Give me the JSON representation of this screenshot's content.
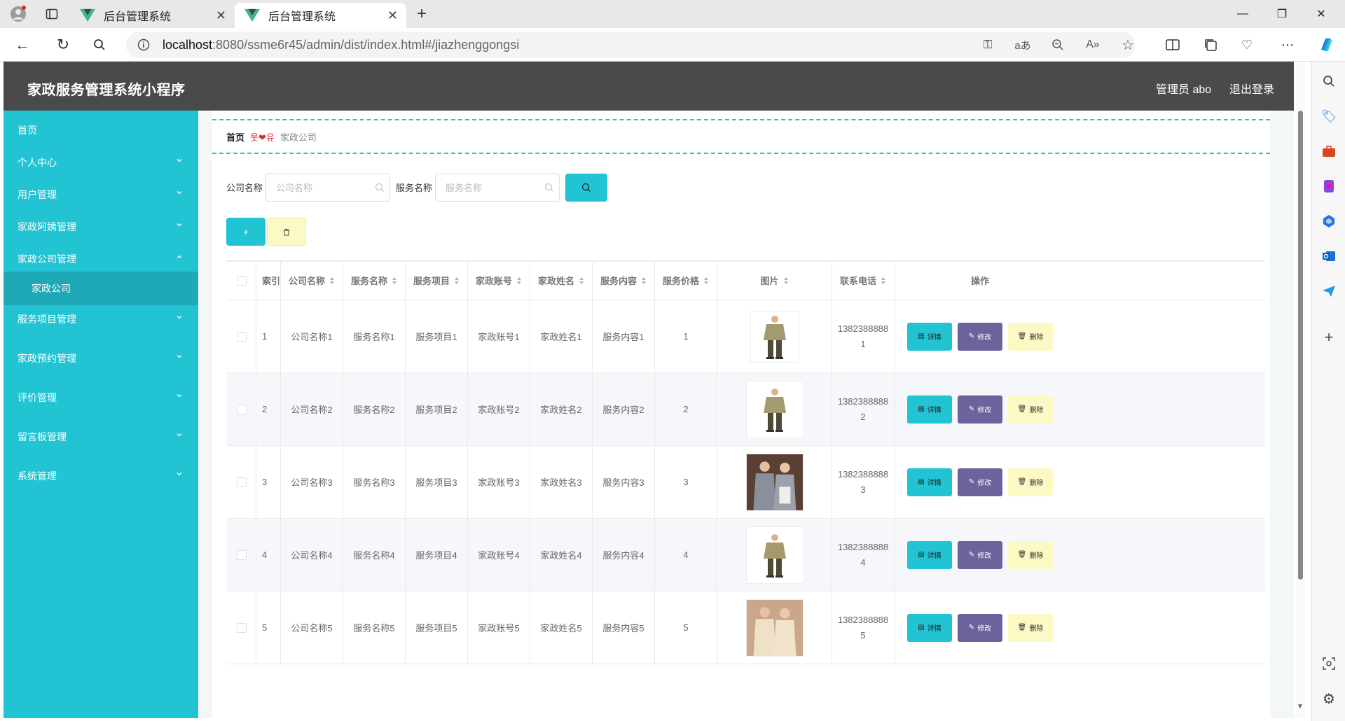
{
  "browser": {
    "tabs": [
      {
        "title": "后台管理系统",
        "active": false
      },
      {
        "title": "后台管理系统",
        "active": true
      }
    ],
    "url_host": "localhost",
    "url_rest": ":8080/ssme6r45/admin/dist/index.html#/jiazhenggongsi",
    "accent": "#22c3d2"
  },
  "app": {
    "title": "家政服务管理系统小程序",
    "admin_label": "管理员 abo",
    "logout_label": "退出登录"
  },
  "sidebar": {
    "items": [
      {
        "label": "首页",
        "expandable": false
      },
      {
        "label": "个人中心",
        "expandable": true
      },
      {
        "label": "用户管理",
        "expandable": true
      },
      {
        "label": "家政阿姨管理",
        "expandable": true
      },
      {
        "label": "家政公司管理",
        "expandable": true,
        "expanded": true
      },
      {
        "label": "家政公司",
        "sub": true
      },
      {
        "label": "服务项目管理",
        "expandable": true
      },
      {
        "label": "家政预约管理",
        "expandable": true
      },
      {
        "label": "评价管理",
        "expandable": true
      },
      {
        "label": "留言板管理",
        "expandable": true
      },
      {
        "label": "系统管理",
        "expandable": true
      }
    ]
  },
  "breadcrumb": {
    "home": "首页",
    "separator": "웃❤유",
    "current": "家政公司"
  },
  "search": {
    "company_label": "公司名称",
    "company_placeholder": "公司名称",
    "service_label": "服务名称",
    "service_placeholder": "服务名称"
  },
  "toolbar": {
    "add_label": "+",
    "delete_icon": "trash-icon"
  },
  "table": {
    "columns": [
      "索引",
      "公司名称",
      "服务名称",
      "服务项目",
      "家政账号",
      "家政姓名",
      "服务内容",
      "服务价格",
      "图片",
      "联系电话",
      "操作"
    ],
    "actions": {
      "detail": "详情",
      "edit": "修改",
      "remove": "删除"
    },
    "rows": [
      {
        "index": "1",
        "company": "公司名称1",
        "service": "服务名称1",
        "item": "服务项目1",
        "account": "家政账号1",
        "name": "家政姓名1",
        "content": "服务内容1",
        "price": "1",
        "phone_a": "1382388888",
        "phone_b": "1",
        "image": "uniform-single"
      },
      {
        "index": "2",
        "company": "公司名称2",
        "service": "服务名称2",
        "item": "服务项目2",
        "account": "家政账号2",
        "name": "家政姓名2",
        "content": "服务内容2",
        "price": "2",
        "phone_a": "1382388888",
        "phone_b": "2",
        "image": "uniform-single"
      },
      {
        "index": "3",
        "company": "公司名称3",
        "service": "服务名称3",
        "item": "服务项目3",
        "account": "家政账号3",
        "name": "家政姓名3",
        "content": "服务内容3",
        "price": "3",
        "phone_a": "1382388888",
        "phone_b": "3",
        "image": "uniform-pair-grey"
      },
      {
        "index": "4",
        "company": "公司名称4",
        "service": "服务名称4",
        "item": "服务项目4",
        "account": "家政账号4",
        "name": "家政姓名4",
        "content": "服务内容4",
        "price": "4",
        "phone_a": "1382388888",
        "phone_b": "4",
        "image": "uniform-single"
      },
      {
        "index": "5",
        "company": "公司名称5",
        "service": "服务名称5",
        "item": "服务项目5",
        "account": "家政账号5",
        "name": "家政姓名5",
        "content": "服务内容5",
        "price": "5",
        "phone_a": "1382388888",
        "phone_b": "5",
        "image": "uniform-pair-beige"
      }
    ]
  }
}
